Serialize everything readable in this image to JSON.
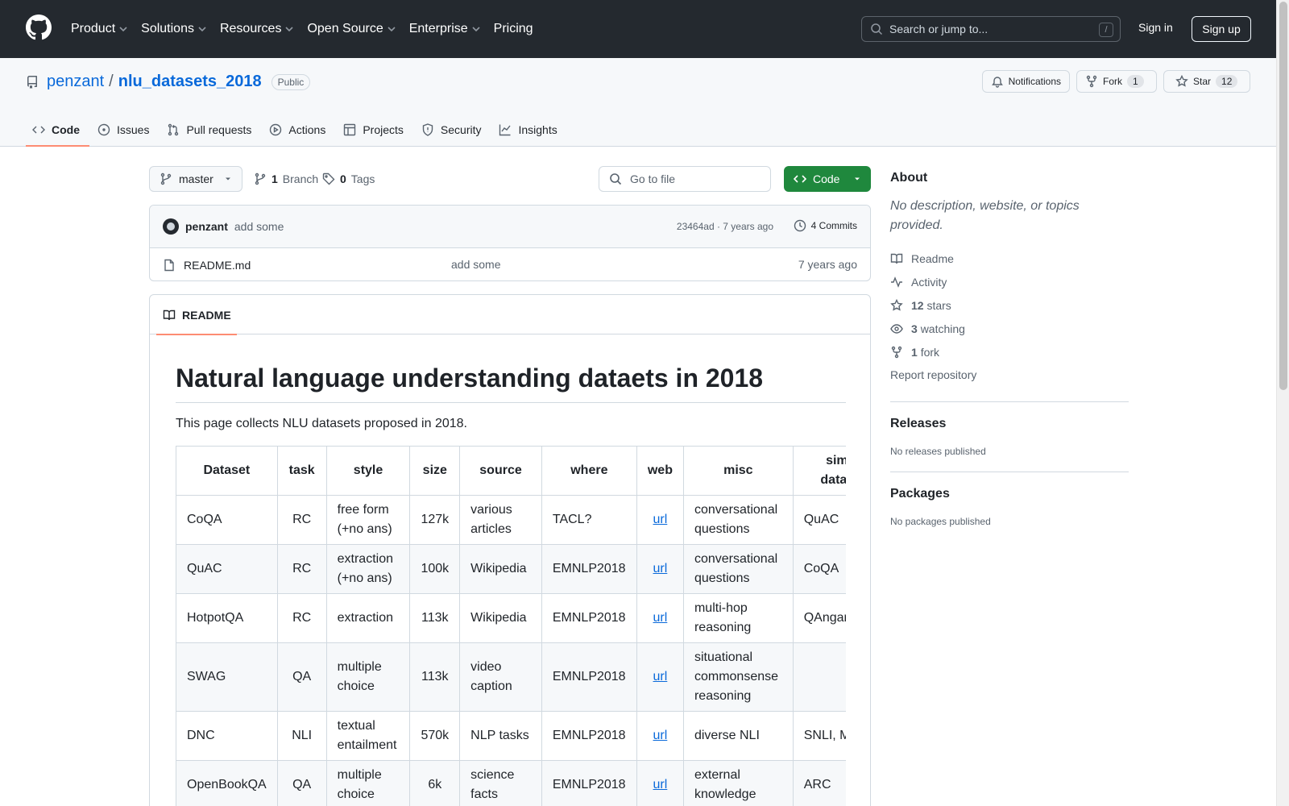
{
  "header": {
    "nav": [
      {
        "label": "Product",
        "has_menu": true
      },
      {
        "label": "Solutions",
        "has_menu": true
      },
      {
        "label": "Resources",
        "has_menu": true
      },
      {
        "label": "Open Source",
        "has_menu": true
      },
      {
        "label": "Enterprise",
        "has_menu": true
      },
      {
        "label": "Pricing",
        "has_menu": false
      }
    ],
    "search_placeholder": "Search or jump to...",
    "search_key": "/",
    "sign_in": "Sign in",
    "sign_up": "Sign up"
  },
  "repo": {
    "owner": "penzant",
    "separator": "/",
    "name": "nlu_datasets_2018",
    "visibility": "Public",
    "notifications_label": "Notifications",
    "fork_label": "Fork",
    "fork_count": "1",
    "star_label": "Star",
    "star_count": "12",
    "tabs": [
      {
        "label": "Code",
        "icon": "code-icon",
        "active": true
      },
      {
        "label": "Issues",
        "icon": "issue-icon",
        "active": false
      },
      {
        "label": "Pull requests",
        "icon": "pull-request-icon",
        "active": false
      },
      {
        "label": "Actions",
        "icon": "play-icon",
        "active": false
      },
      {
        "label": "Projects",
        "icon": "table-icon",
        "active": false
      },
      {
        "label": "Security",
        "icon": "shield-icon",
        "active": false
      },
      {
        "label": "Insights",
        "icon": "graph-icon",
        "active": false
      }
    ]
  },
  "file_nav": {
    "branch": "master",
    "branch_count": "1",
    "branch_label": "Branch",
    "tag_count": "0",
    "tag_label": "Tags",
    "goto_placeholder": "Go to file",
    "code_button": "Code"
  },
  "latest_commit": {
    "author": "penzant",
    "message": "add some",
    "meta": "23464ad · 7 years ago",
    "commits_label": "4 Commits"
  },
  "files": [
    {
      "name": "README.md",
      "message": "add some",
      "time": "7 years ago"
    }
  ],
  "readme": {
    "tab_label": "README",
    "title": "Natural language understanding dataets in 2018",
    "intro": "This page collects NLU datasets proposed in 2018.",
    "table": {
      "headers": [
        "Dataset",
        "task",
        "style",
        "size",
        "source",
        "where",
        "web",
        "misc",
        "similar datasets"
      ],
      "rows": [
        [
          "CoQA",
          "RC",
          "free form (+no ans)",
          "127k",
          "various articles",
          "TACL?",
          "url",
          "conversational questions",
          "QuAC"
        ],
        [
          "QuAC",
          "RC",
          "extraction (+no ans)",
          "100k",
          "Wikipedia",
          "EMNLP2018",
          "url",
          "conversational questions",
          "CoQA"
        ],
        [
          "HotpotQA",
          "RC",
          "extraction",
          "113k",
          "Wikipedia",
          "EMNLP2018",
          "url",
          "multi-hop reasoning",
          "QAngaroo"
        ],
        [
          "SWAG",
          "QA",
          "multiple choice",
          "113k",
          "video caption",
          "EMNLP2018",
          "url",
          "situational commonsense reasoning",
          ""
        ],
        [
          "DNC",
          "NLI",
          "textual entailment",
          "570k",
          "NLP tasks",
          "EMNLP2018",
          "url",
          "diverse NLI",
          "SNLI, MultiNLI"
        ],
        [
          "OpenBookQA",
          "QA",
          "multiple choice",
          "6k",
          "science facts",
          "EMNLP2018",
          "url",
          "external knowledge",
          "ARC"
        ]
      ]
    }
  },
  "sidebar": {
    "about_title": "About",
    "about_desc": "No description, website, or topics provided.",
    "items": [
      {
        "icon": "book-icon",
        "count": "",
        "label": "Readme"
      },
      {
        "icon": "pulse-icon",
        "count": "",
        "label": "Activity"
      },
      {
        "icon": "star-icon",
        "count": "12",
        "label": "stars"
      },
      {
        "icon": "eye-icon",
        "count": "3",
        "label": "watching"
      },
      {
        "icon": "fork-icon",
        "count": "1",
        "label": "fork"
      }
    ],
    "report": "Report repository",
    "releases_title": "Releases",
    "releases_text": "No releases published",
    "packages_title": "Packages",
    "packages_text": "No packages published"
  },
  "colors": {
    "header_bg": "#24292f",
    "link": "#0969da",
    "code_button": "#1f883d",
    "tab_underline": "#fd8c73"
  }
}
